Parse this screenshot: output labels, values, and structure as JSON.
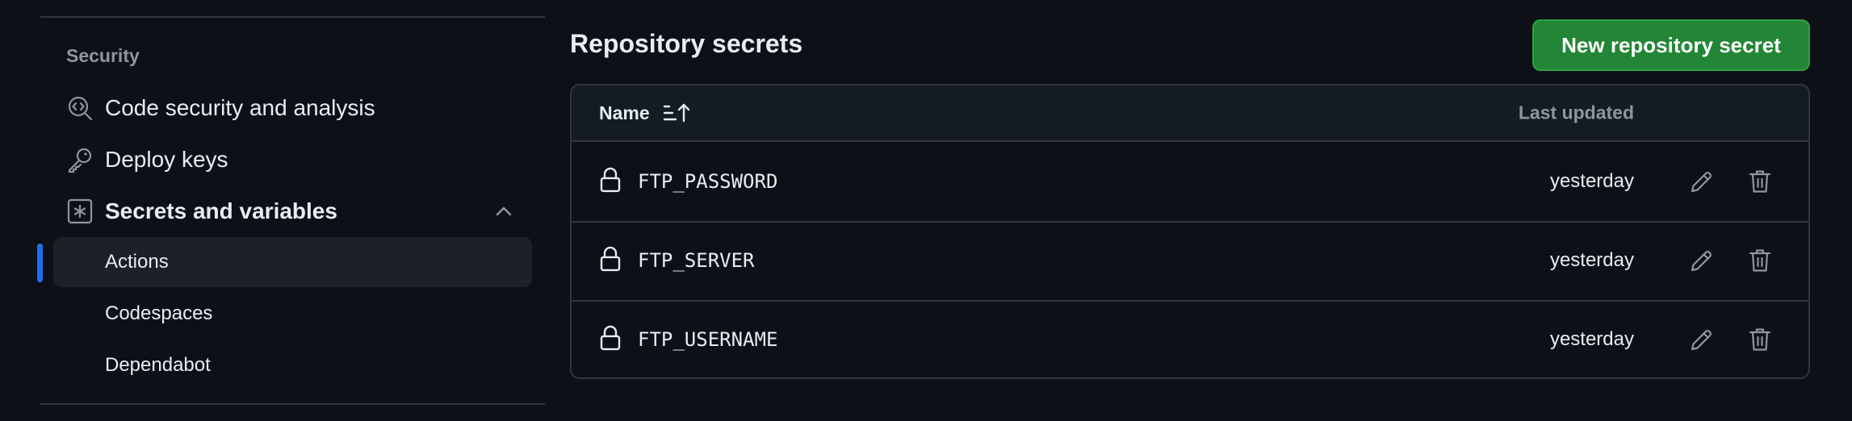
{
  "sidebar": {
    "section_title": "Security",
    "items": [
      {
        "label": "Code security and analysis",
        "icon": "codescan-icon"
      },
      {
        "label": "Deploy keys",
        "icon": "key-icon"
      },
      {
        "label": "Secrets and variables",
        "icon": "asterisk-box-icon",
        "expanded": true
      }
    ],
    "sub_items": [
      {
        "label": "Actions",
        "active": true
      },
      {
        "label": "Codespaces",
        "active": false
      },
      {
        "label": "Dependabot",
        "active": false
      }
    ]
  },
  "main": {
    "title": "Repository secrets",
    "new_button_label": "New repository secret",
    "table": {
      "col_name": "Name",
      "col_updated": "Last updated",
      "rows": [
        {
          "name": "FTP_PASSWORD",
          "updated": "yesterday"
        },
        {
          "name": "FTP_SERVER",
          "updated": "yesterday"
        },
        {
          "name": "FTP_USERNAME",
          "updated": "yesterday"
        }
      ]
    }
  },
  "colors": {
    "background": "#0d1117",
    "accent_blue": "#1f6feb",
    "button_green": "#238636",
    "border": "#30363d",
    "muted_text": "#8d96a0"
  }
}
